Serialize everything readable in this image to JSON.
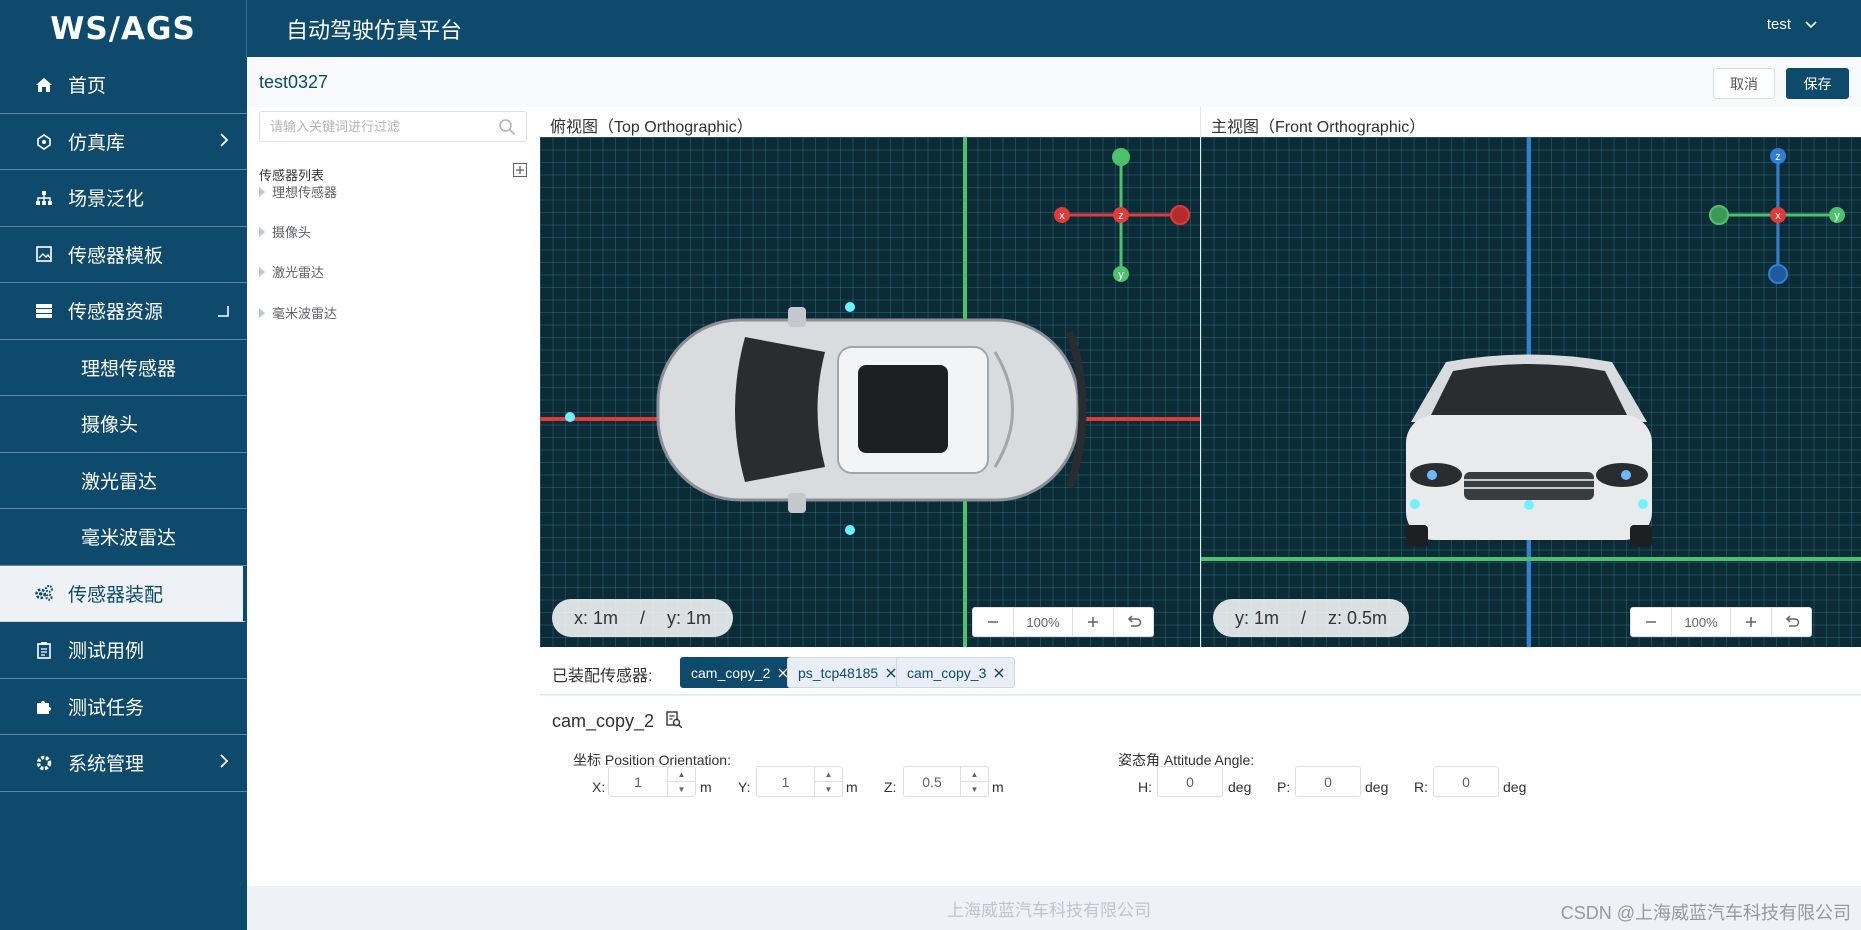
{
  "header": {
    "logo": "WS/AGS",
    "title": "自动驾驶仿真平台",
    "user": "test"
  },
  "sidebar": {
    "items": [
      {
        "label": "首页",
        "icon": "home-icon"
      },
      {
        "label": "仿真库",
        "icon": "library-icon"
      },
      {
        "label": "场景泛化",
        "icon": "sitemap-icon"
      },
      {
        "label": "传感器模板",
        "icon": "image-icon"
      },
      {
        "label": "传感器资源",
        "icon": "server-icon"
      },
      {
        "label": "理想传感器"
      },
      {
        "label": "摄像头"
      },
      {
        "label": "激光雷达"
      },
      {
        "label": "毫米波雷达"
      },
      {
        "label": "传感器装配",
        "icon": "gears-icon"
      },
      {
        "label": "测试用例",
        "icon": "clipboard-icon"
      },
      {
        "label": "测试任务",
        "icon": "puzzle-icon"
      },
      {
        "label": "系统管理",
        "icon": "gear-icon"
      }
    ]
  },
  "page": {
    "name": "test0327",
    "cancel": "取消",
    "save": "保存"
  },
  "tree": {
    "search_placeholder": "请输入关键词进行过滤",
    "head": "传感器列表",
    "items": [
      "理想传感器",
      "摄像头",
      "激光雷达",
      "毫米波雷达"
    ]
  },
  "viewports": {
    "top": {
      "title": "俯视图（Top Orthographic）",
      "c1": "x: 1m",
      "sep": "/",
      "c2": "y: 1m",
      "zoom": "100%",
      "gizmo": {
        "a": "x",
        "b": "z",
        "c": "y"
      }
    },
    "front": {
      "title": "主视图（Front Orthographic）",
      "c1": "y: 1m",
      "sep": "/",
      "c2": "z: 0.5m",
      "zoom": "100%",
      "gizmo": {
        "a": "z",
        "b": "x",
        "c": "y"
      }
    }
  },
  "assembled": {
    "label": "已装配传感器:",
    "tags": [
      "cam_copy_2",
      "ps_tcp48185",
      "cam_copy_3"
    ]
  },
  "detail": {
    "name": "cam_copy_2",
    "position_label": "坐标 Position Orientation:",
    "attitude_label": "姿态角 Attitude Angle:",
    "x": {
      "label": "X:",
      "value": "1",
      "unit": "m"
    },
    "y": {
      "label": "Y:",
      "value": "1",
      "unit": "m"
    },
    "z": {
      "label": "Z:",
      "value": "0.5",
      "unit": "m"
    },
    "h": {
      "label": "H:",
      "value": "0",
      "unit": "deg"
    },
    "p": {
      "label": "P:",
      "value": "0",
      "unit": "deg"
    },
    "r": {
      "label": "R:",
      "value": "0",
      "unit": "deg"
    }
  },
  "footer": {
    "copyright": "上海威蓝汽车科技有限公司",
    "watermark": "CSDN @上海威蓝汽车科技有限公司"
  },
  "colors": {
    "primary": "#0d4a6b",
    "axis_red": "#e03a3a",
    "axis_green": "#4cc26c",
    "axis_blue": "#2f7fd6"
  }
}
